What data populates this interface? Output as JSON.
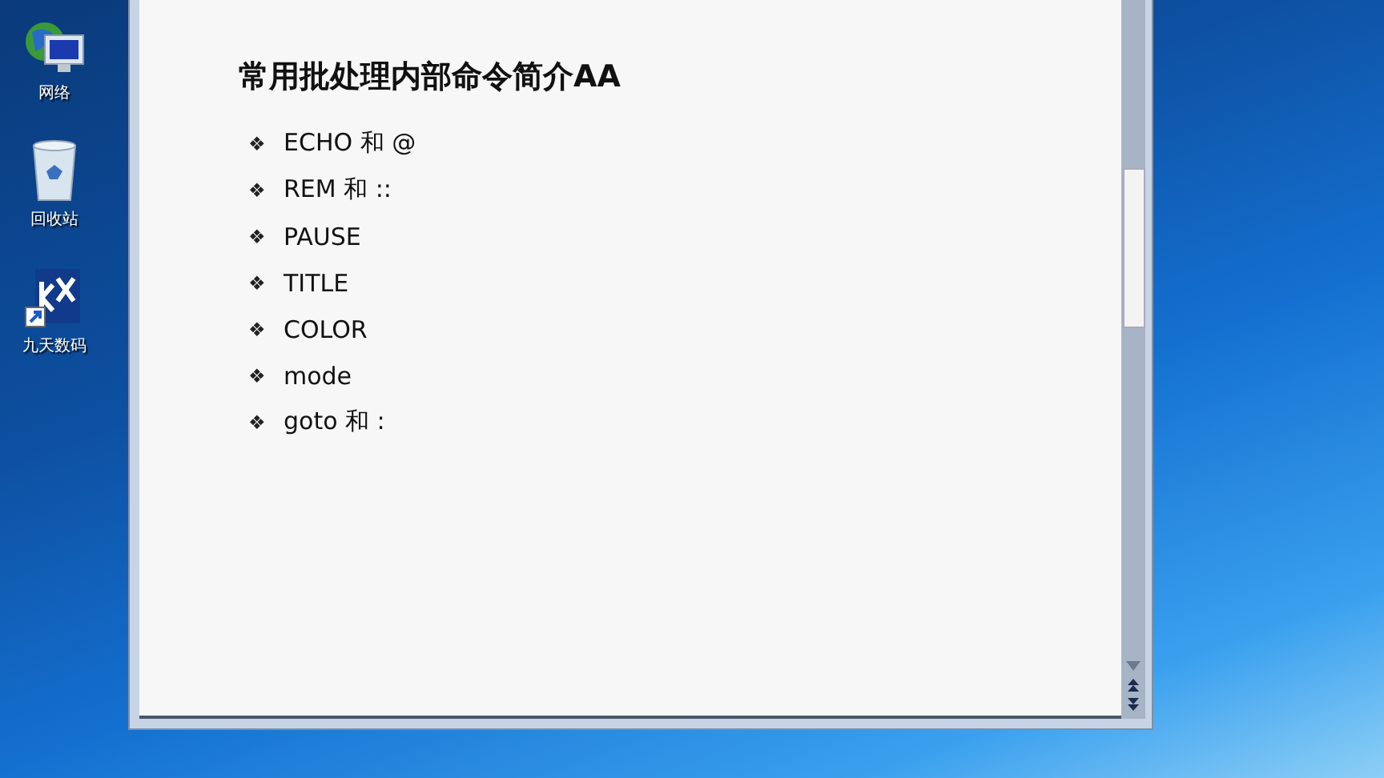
{
  "desktop_icons": [
    {
      "label": "网络",
      "kind": "network"
    },
    {
      "label": "回收站",
      "kind": "recycle"
    },
    {
      "label": "九天数码",
      "kind": "app"
    }
  ],
  "document": {
    "title": "常用批处理内部命令简介AA",
    "bullet": "❖",
    "items": [
      "ECHO 和 @",
      "REM 和 ::",
      "PAUSE",
      "TITLE",
      "COLOR",
      "mode",
      "goto 和 :"
    ]
  }
}
